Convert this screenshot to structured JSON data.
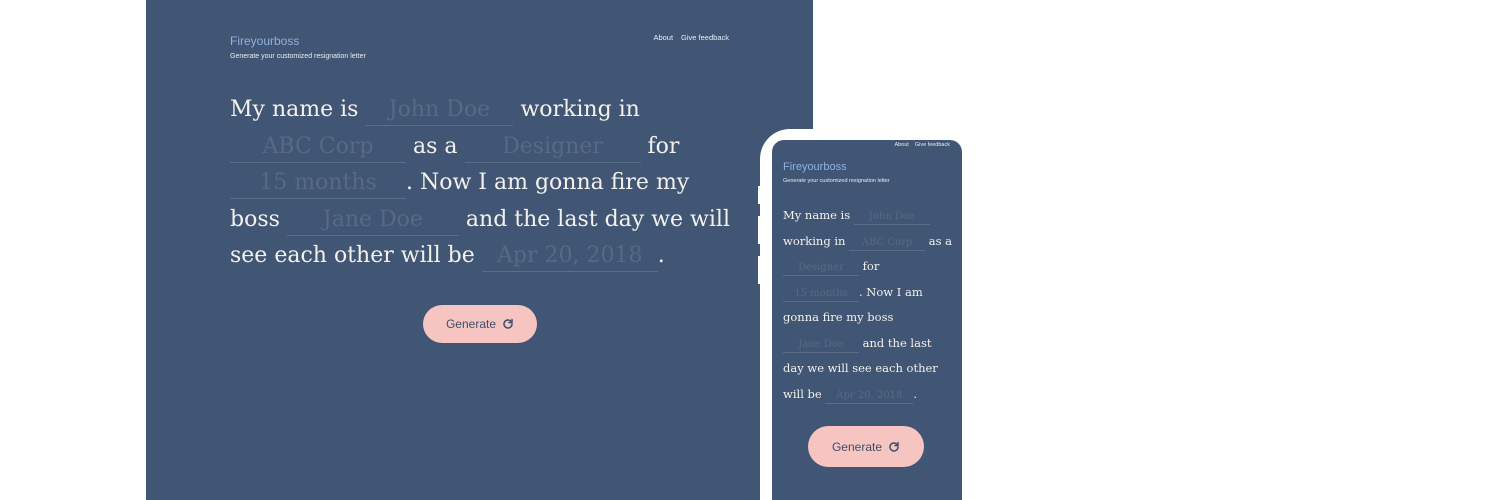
{
  "app": {
    "title": "Fireyourboss",
    "subtitle": "Generate your customized resignation letter"
  },
  "nav": {
    "about": "About",
    "feedback": "Give feedback"
  },
  "letter": {
    "p1": "My name is",
    "name_placeholder": "John Doe",
    "p2": "working in",
    "company_placeholder": "ABC Corp",
    "p3": "as a",
    "role_placeholder": "Designer",
    "p4": "for",
    "duration_placeholder": "15 months",
    "p5": ". Now I am gonna fire my boss",
    "boss_placeholder": "Jane Doe",
    "p6": "and the last day we will see each other will be",
    "date_placeholder": "Apr 20, 2018",
    "p7": "."
  },
  "generate": {
    "label": "Generate",
    "icon": "refresh-icon"
  },
  "colors": {
    "background": "#415674",
    "accent_button": "#f6c5c2",
    "brand": "#8fb0e0",
    "text": "#f4f1ec"
  }
}
